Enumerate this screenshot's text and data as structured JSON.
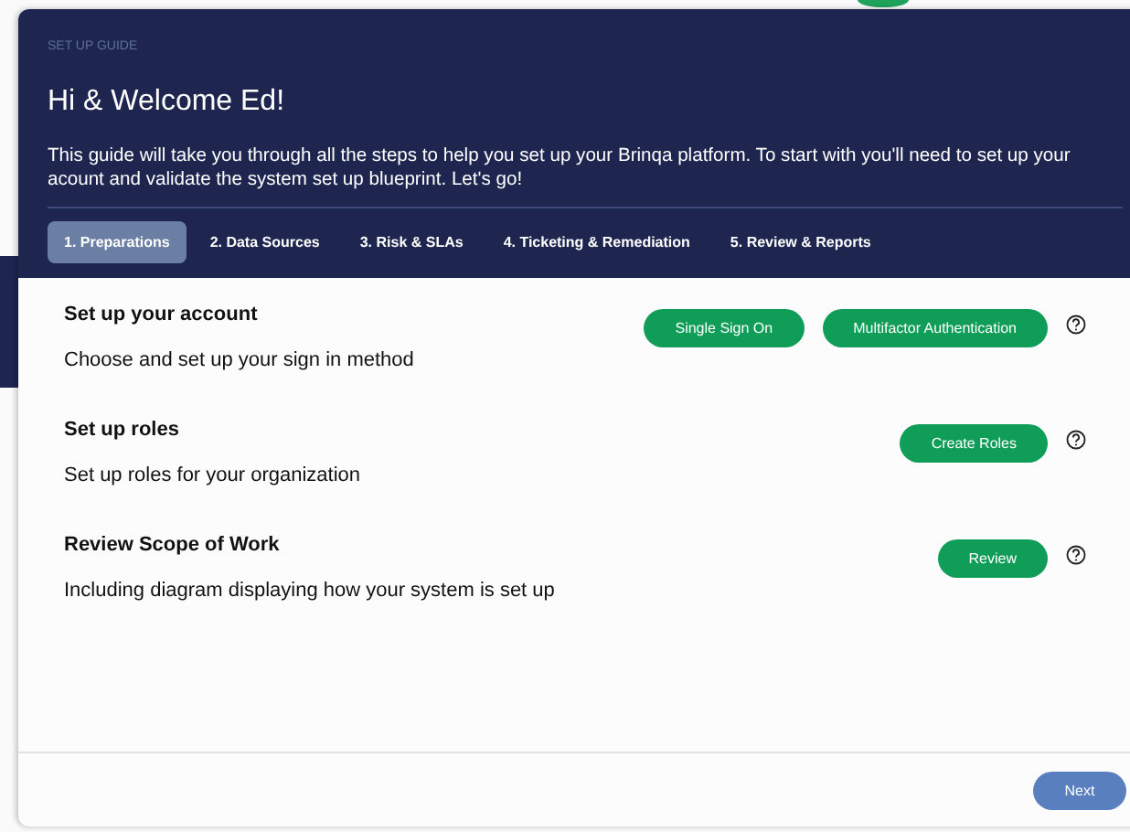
{
  "header": {
    "eyebrow": "SET UP GUIDE",
    "title": "Hi & Welcome Ed!",
    "intro": "This guide will take you through all the steps to help you set up your Brinqa platform. To start with you'll need to set up your acount and validate the system set up blueprint. Let's go!"
  },
  "tabs": [
    {
      "label": "1. Preparations",
      "selected": true
    },
    {
      "label": "2. Data Sources",
      "selected": false
    },
    {
      "label": "3. Risk & SLAs",
      "selected": false
    },
    {
      "label": "4. Ticketing & Remediation",
      "selected": false
    },
    {
      "label": "5. Review & Reports",
      "selected": false
    }
  ],
  "steps": [
    {
      "title": "Set up your account",
      "description": "Choose and set up your sign in method",
      "actions": [
        "Single Sign On",
        "Multifactor Authentication"
      ]
    },
    {
      "title": "Set up roles",
      "description": "Set up roles for your organization",
      "actions": [
        "Create Roles"
      ]
    },
    {
      "title": "Review Scope of Work",
      "description": "Including diagram displaying how your system is set up",
      "actions": [
        "Review"
      ]
    }
  ],
  "footer": {
    "next": "Next"
  }
}
